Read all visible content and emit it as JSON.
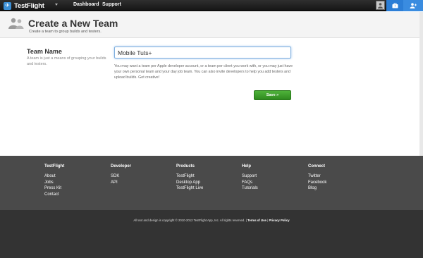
{
  "topbar": {
    "app_name": "TestFlight",
    "nav": {
      "dashboard": "Dashboard",
      "support": "Support"
    }
  },
  "header": {
    "title": "Create a New Team",
    "subtitle": "Create a team to group builds and testers."
  },
  "form": {
    "team_name_label": "Team Name",
    "team_name_help": "A team is just a means of grouping your builds and testers.",
    "team_name_value": "Mobile Tuts+",
    "description": "You may want a team per Apple developer account, or a team per client you work with, or you may just have your own personal team and your day job team. You can also invite developers to help you add testers and upload builds. Get creative!",
    "save_label": "Save »"
  },
  "footer": {
    "columns": [
      {
        "heading": "TestFlight",
        "links": [
          "About",
          "Jobs",
          "Press Kit",
          "Contact"
        ]
      },
      {
        "heading": "Developer",
        "links": [
          "SDK",
          "API"
        ]
      },
      {
        "heading": "Products",
        "links": [
          "TestFlight",
          "Desktop App",
          "TestFlight Live"
        ]
      },
      {
        "heading": "Help",
        "links": [
          "Support",
          "FAQs",
          "Tutorials"
        ]
      },
      {
        "heading": "Connect",
        "links": [
          "Twitter",
          "Facebook",
          "Blog"
        ]
      }
    ],
    "copyright": "All text and design is copyright © 2010-2012 TestFlight App, Inc. All rights reserved. |",
    "terms": "Terms of Use",
    "separator": "|",
    "privacy": "Privacy Policy"
  },
  "colors": {
    "accent_blue": "#2c7ed6",
    "save_green": "#3f9e2d",
    "footer_bg": "#4a4a4a",
    "bottom_bg": "#333333"
  }
}
